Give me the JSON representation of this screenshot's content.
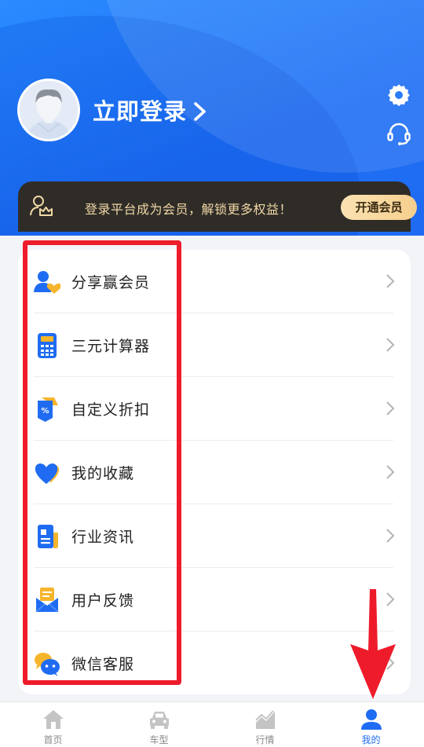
{
  "header": {
    "login_label": "立即登录",
    "icons": {
      "settings": "gear-icon",
      "support": "headset-icon"
    }
  },
  "banner": {
    "text": "登录平台成为会员，解锁更多权益！",
    "button": "开通会员"
  },
  "menu": {
    "items": [
      {
        "label": "分享赢会员",
        "icon": "share-user-icon"
      },
      {
        "label": "三元计算器",
        "icon": "calculator-icon"
      },
      {
        "label": "自定义折扣",
        "icon": "discount-tag-icon"
      },
      {
        "label": "我的收藏",
        "icon": "heart-icon"
      },
      {
        "label": "行业资讯",
        "icon": "news-icon"
      },
      {
        "label": "用户反馈",
        "icon": "feedback-mail-icon"
      },
      {
        "label": "微信客服",
        "icon": "wechat-icon"
      }
    ]
  },
  "nav": {
    "items": [
      {
        "label": "首页",
        "icon": "home-icon"
      },
      {
        "label": "车型",
        "icon": "car-icon"
      },
      {
        "label": "行情",
        "icon": "chart-icon"
      },
      {
        "label": "我的",
        "icon": "user-icon",
        "active": true
      }
    ]
  },
  "colors": {
    "primary": "#1f6cf2",
    "highlight": "#ee1c2b",
    "gold": "#f6cf8d"
  }
}
